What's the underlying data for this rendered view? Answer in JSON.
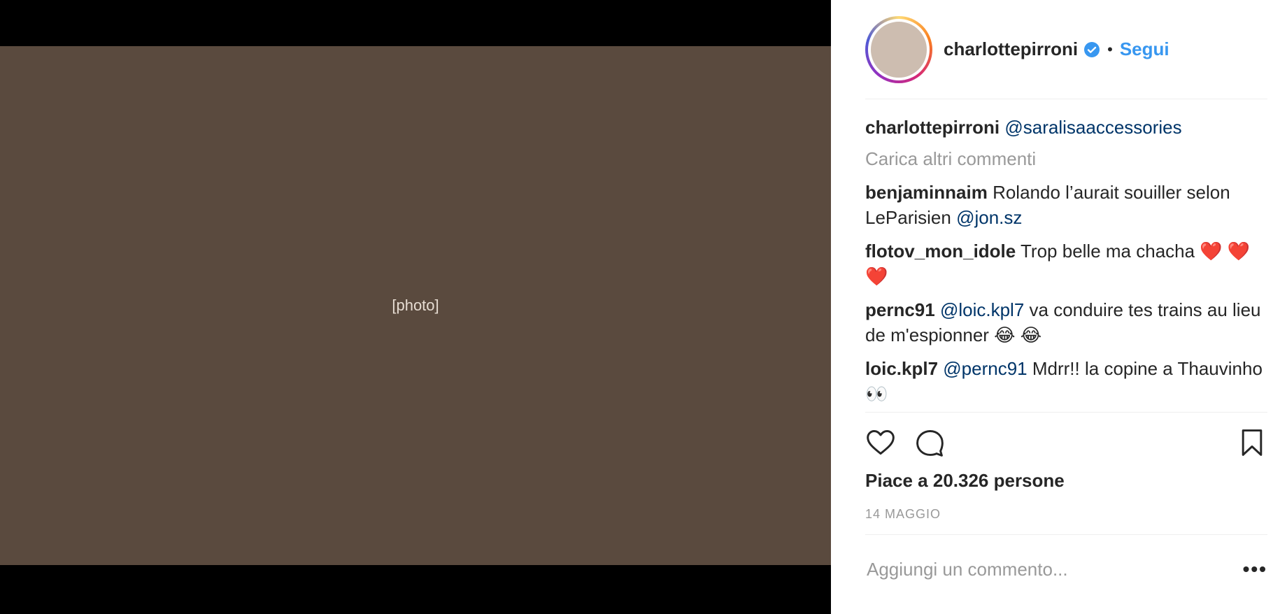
{
  "media": {
    "note": "[photo]"
  },
  "header": {
    "username": "charlottepirroni",
    "separator": "•",
    "follow_label": "Segui"
  },
  "caption": {
    "username": "charlottepirroni",
    "mention": "@saralisaaccessories"
  },
  "load_more": "Carica altri commenti",
  "comments": [
    {
      "username": "benjaminnaim",
      "text": "Rolando l’aurait souiller selon LeParisien",
      "mention": "@jon.sz"
    },
    {
      "username": "flotov_mon_idole",
      "text": "Trop belle ma chacha ❤️ ❤️ ❤️"
    },
    {
      "username": "pernc91",
      "mention": "@loic.kpl7",
      "text": "va conduire tes trains au lieu de m'espionner 😂 😂"
    },
    {
      "username": "loic.kpl7",
      "mention": "@pernc91",
      "text": "Mdrr!! la copine a Thauvinho👀"
    }
  ],
  "likes": "Piace a 20.326 persone",
  "date": "14 MAGGIO",
  "add_comment": {
    "placeholder": "Aggiungi un commento...",
    "more": "•••"
  }
}
